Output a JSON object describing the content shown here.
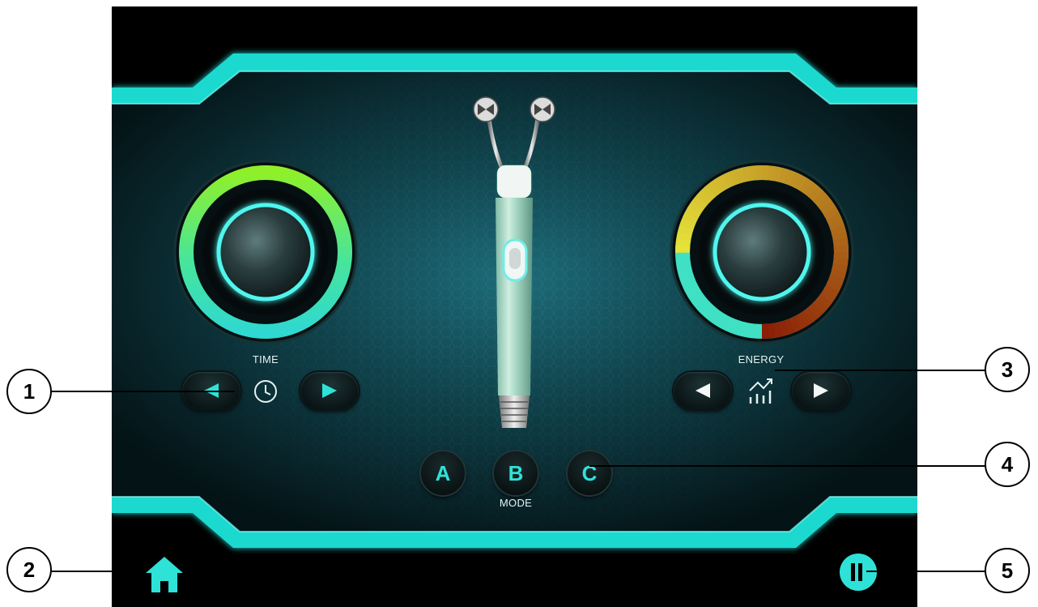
{
  "panel": {
    "time_label": "TIME",
    "energy_label": "ENERGY",
    "mode_label": "MODE"
  },
  "time": {
    "decrease_icon": "triangle-left",
    "clock_icon": "clock-icon",
    "increase_icon": "triangle-right"
  },
  "energy": {
    "decrease_icon": "triangle-left",
    "chart_icon": "bar-chart-trend-icon",
    "increase_icon": "triangle-right",
    "level": 0.75
  },
  "modes": [
    {
      "label": "A"
    },
    {
      "label": "B"
    },
    {
      "label": "C"
    }
  ],
  "bottom_bar": {
    "home_icon": "home-icon",
    "pause_icon": "pause-icon"
  },
  "callouts": [
    {
      "number": "1"
    },
    {
      "number": "2"
    },
    {
      "number": "3"
    },
    {
      "number": "4"
    },
    {
      "number": "5"
    }
  ],
  "colors": {
    "accent": "#2fe2d8",
    "frame": "#1dd6cf",
    "background": "#000000",
    "time_ring": "#7fe83a",
    "energy_ring_start": "#e6e23a",
    "energy_ring_end": "#8a1e06"
  }
}
